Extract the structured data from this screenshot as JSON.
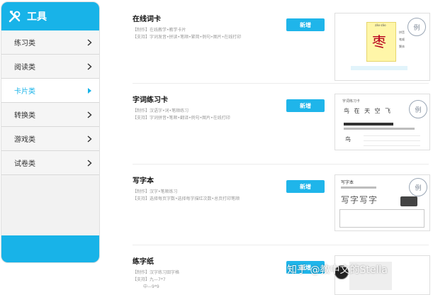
{
  "sidebar": {
    "title": "工具",
    "items": [
      {
        "label": "练习类",
        "active": false
      },
      {
        "label": "阅读类",
        "active": false
      },
      {
        "label": "卡片类",
        "active": true
      },
      {
        "label": "转换类",
        "active": false
      },
      {
        "label": "游戏类",
        "active": false
      },
      {
        "label": "试卷类",
        "active": false
      }
    ]
  },
  "rows": [
    {
      "title": "在线词卡",
      "make": "【制作】在线教学•教学卡片",
      "support": "【支持】字词发音•拼读•笔顺•繁简•例句•图片•在线打印",
      "button": "新增"
    },
    {
      "title": "字词练习卡",
      "make": "【制作】汉语字•词•笔顺练习",
      "support": "【支持】字词拼音•笔顺•翻译•例句•图片•在线打印",
      "button": "新增"
    },
    {
      "title": "写字本",
      "make": "【制作】汉字•笔顺练习",
      "support": "【支持】选择每页字数•选择每字描红次数•总页打印笔顺",
      "button": "新增"
    },
    {
      "title": "练字纸",
      "make": "【制作】汉字练习田字格",
      "support1": "【支持】九—7*7",
      "support2": "中—9*9",
      "button": "新增"
    }
  ],
  "thumbs": {
    "card": {
      "pinyin": "zǎo-zǎo",
      "char": "枣",
      "tags": [
        "拼音",
        "笔顺",
        "繁体"
      ],
      "stamp": "例"
    },
    "practice": {
      "header": "字词练习卡",
      "words": "鸟 在 天 空 飞",
      "char": "鸟",
      "stamp": "例"
    },
    "copybook": {
      "header": "写字本",
      "chars": "写字写字",
      "stamp": "例"
    }
  },
  "watermark": "知乎 @教中文的Stella"
}
